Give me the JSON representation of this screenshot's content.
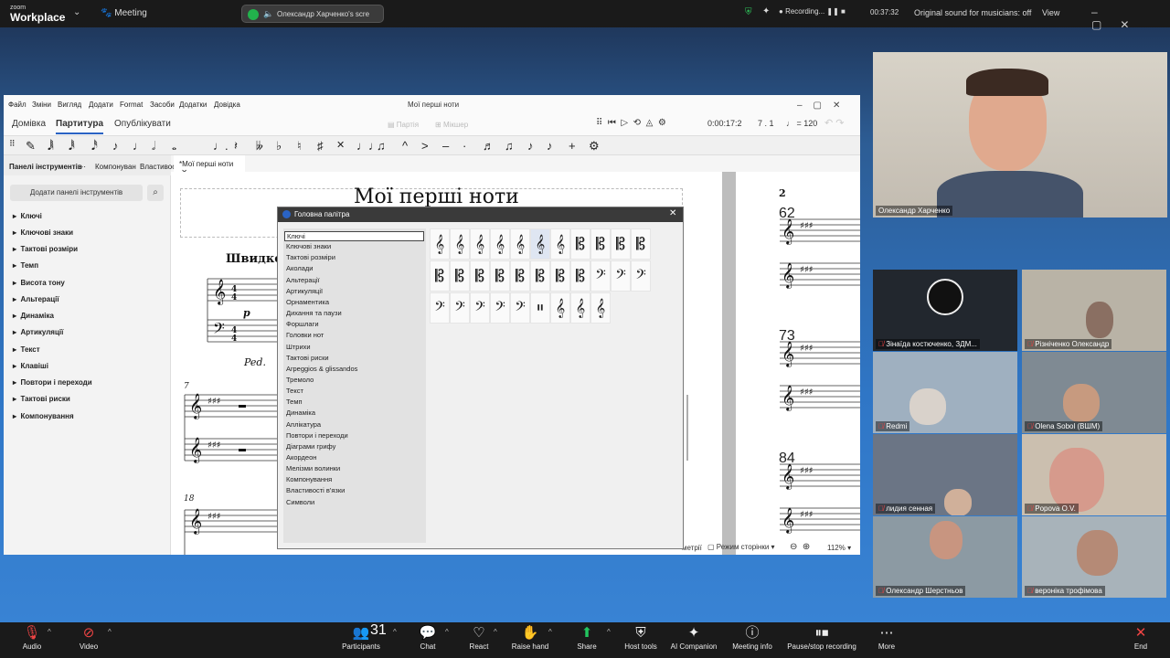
{
  "zoom": {
    "logo_top": "zoom",
    "logo_bottom": "Workplace",
    "meeting_label": "Meeting",
    "share_label": "Олександр Харченко's scre",
    "recording_label": "Recording...",
    "timer": "00:37:32",
    "original_sound": "Original sound for musicians: off",
    "view_label": "View"
  },
  "musescore": {
    "menu": [
      "Файл",
      "Зміни",
      "Вигляд",
      "Додати",
      "Format",
      "Засоби",
      "Додатки",
      "Довідка"
    ],
    "window_title": "Мої перші ноти",
    "tabs": [
      "Домівка",
      "Партитура",
      "Опублікувати"
    ],
    "active_tab": "Партитура",
    "disabled_tabs": [
      "Партія",
      "Мікшер"
    ],
    "playback_time": "0:00:17:2",
    "position": "7 . 1",
    "tempo": "♩ = 120",
    "panel_tabs": [
      "Панелі інструментів",
      "Компонуван",
      "Властивос"
    ],
    "add_panel_button": "Додати панелі інструментів",
    "panels": [
      "Ключі",
      "Ключові знаки",
      "Тактові розміри",
      "Темп",
      "Висота тону",
      "Альтерації",
      "Динаміка",
      "Артикуляції",
      "Текст",
      "Клавіші",
      "Повтори і переходи",
      "Тактові риски",
      "Компонування"
    ],
    "doc_tab": "*Мої перші ноти",
    "score": {
      "title": "Мої перші ноти",
      "tempo_text": "Швидко",
      "dynamic": "p",
      "pedal": "Ped.",
      "bar_numbers": [
        "7",
        "18"
      ],
      "page_number": "2",
      "page2_bar_numbers": [
        "62",
        "73",
        "84"
      ]
    },
    "statusbar": {
      "partial_text": "метрії",
      "page_mode": "Режим сторінки",
      "zoom": "112%"
    }
  },
  "palette": {
    "title": "Головна палітра",
    "categories": [
      "Ключі",
      "Ключові знаки",
      "Тактові розміри",
      "Аколади",
      "Альтерації",
      "Артикуляції",
      "Орнаментика",
      "Дихання та паузи",
      "Форшлаги",
      "Головки нот",
      "Штрихи",
      "Тактові риски",
      "Arpeggios & glissandos",
      "Тремоло",
      "Текст",
      "Темп",
      "Динаміка",
      "Аплікатура",
      "Повтори і переходи",
      "Діаграми грифу",
      "Акордеон",
      "Мелізми волинки",
      "Компонування",
      "Властивості в'язки",
      "Символи"
    ],
    "selected_category": "Ключі",
    "clef_rows": [
      [
        "𝄞",
        "𝄞",
        "𝄞",
        "𝄞",
        "𝄞",
        "𝄞",
        "𝄞",
        "𝄡",
        "𝄡",
        "𝄡",
        "𝄡"
      ],
      [
        "𝄡",
        "𝄡",
        "𝄡",
        "𝄡",
        "𝄡",
        "𝄡",
        "𝄡",
        "𝄡",
        "𝄢",
        "𝄢",
        "𝄢"
      ],
      [
        "𝄢",
        "𝄢",
        "𝄢",
        "𝄢",
        "𝄢",
        "𝄥",
        "𝄞",
        "𝄞",
        "𝄞"
      ]
    ]
  },
  "participants": {
    "speaker": "Олександр Харченко",
    "tiles": [
      "Зінаїда костюченко, ЗДМ...",
      "Різніченко Олександр",
      "Redmi",
      "Olena Sobol (ВШМ)",
      "лидия сенная",
      "Popova O.V.",
      "Олександр Шерстньов",
      "вероніка трофімова"
    ]
  },
  "toolbar": {
    "items": [
      "Audio",
      "Video",
      "Participants",
      "Chat",
      "React",
      "Raise hand",
      "Share",
      "Host tools",
      "AI Companion",
      "Meeting info",
      "Pause/stop recording",
      "More",
      "End"
    ],
    "participant_count": "31"
  }
}
